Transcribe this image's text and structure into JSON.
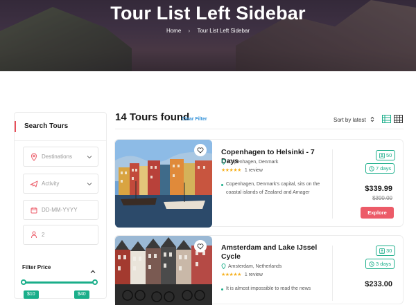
{
  "hero": {
    "title": "Tour List Left Sidebar",
    "breadcrumb": {
      "home": "Home",
      "separator": "›",
      "current": "Tour List Left Sidebar"
    }
  },
  "sidebar": {
    "title": "Search Tours",
    "fields": [
      {
        "placeholder": "Destinations",
        "icon": "map-pin-icon",
        "dropdown": true
      },
      {
        "placeholder": "Activity",
        "icon": "plane-icon",
        "dropdown": true
      },
      {
        "placeholder": "DD-MM-YYYY",
        "icon": "calendar-icon",
        "dropdown": false
      },
      {
        "value": "2",
        "icon": "person-icon",
        "dropdown": false
      }
    ],
    "filter_price": {
      "title": "Filter Price",
      "min_label": "$10",
      "max_label": "$40"
    }
  },
  "results": {
    "count_text": "14 Tours found",
    "clear_filter": "Clear Filter",
    "sort_label": "Sort by latest",
    "active_view": "list"
  },
  "tours": [
    {
      "title": "Copenhagen to Helsinki - 7 Days",
      "location": "Copenhagen, Denmark",
      "rating_stars": 5,
      "reviews": "1 review",
      "description": "Copenhagen, Denmark's capital, sits on the coastal islands of Zealand and Amager",
      "group_size": "50",
      "duration": "7 days",
      "price": "$339.99",
      "old_price": "$390.00",
      "cta": "Explore"
    },
    {
      "title": "Amsterdam and Lake IJssel Cycle",
      "location": "Amsterdam, Netherlands",
      "rating_stars": 5,
      "reviews": "1 review",
      "description": "It is almost impossible to read the news",
      "group_size": "30",
      "duration": "3 days",
      "price": "$233.00",
      "old_price": "",
      "cta": ""
    }
  ],
  "colors": {
    "accent": "#1aae8a",
    "cta": "#ec5b68",
    "link": "#2e8fd8",
    "star": "#f6b01e"
  }
}
